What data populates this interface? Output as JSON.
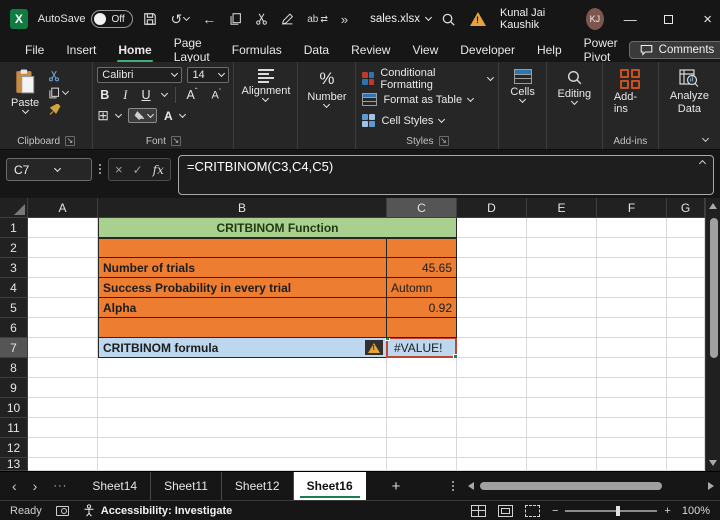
{
  "titlebar": {
    "autosave_label": "AutoSave",
    "autosave_state": "Off",
    "filename": "sales.xlsx",
    "user_name": "Kunal Jai Kaushik",
    "user_initials": "KJ"
  },
  "ribbon_tabs": [
    "File",
    "Insert",
    "Home",
    "Page Layout",
    "Formulas",
    "Data",
    "Review",
    "View",
    "Developer",
    "Help",
    "Power Pivot"
  ],
  "active_tab": "Home",
  "tab_actions": {
    "comments": "Comments"
  },
  "ribbon": {
    "paste": "Paste",
    "clipboard_group": "Clipboard",
    "font_group": "Font",
    "font_name": "Calibri",
    "font_size": "14",
    "bold": "B",
    "italic": "I",
    "underline": "U",
    "font_color_letter": "A",
    "grow_font": "A",
    "shrink_font": "A",
    "alignment": "Alignment",
    "number": "Number",
    "conditional_formatting": "Conditional Formatting",
    "format_as_table": "Format as Table",
    "cell_styles": "Cell Styles",
    "styles_group": "Styles",
    "cells": "Cells",
    "editing": "Editing",
    "addins_button": "Add-ins",
    "addins_group": "Add-ins",
    "analyze_data": "Analyze Data"
  },
  "formula_bar": {
    "name_box": "C7",
    "fx": "fx",
    "formula": "=CRITBINOM(C3,C4,C5)"
  },
  "sheet": {
    "columns": [
      "A",
      "B",
      "C",
      "D",
      "E",
      "F",
      "G"
    ],
    "selected_column": "C",
    "selected_row": 7,
    "rows_visible": 13,
    "cell_map": {
      "B1": {
        "text": "CRITBINOM Function",
        "bg": "green",
        "bold": true,
        "align": "center",
        "span": 2,
        "color": "#1f3a10"
      },
      "B2": {
        "bg": "orange"
      },
      "C2": {
        "bg": "orange"
      },
      "B3": {
        "text": "Number of trials",
        "bg": "orange",
        "bold": true
      },
      "C3": {
        "text": "45.65",
        "bg": "orange",
        "align": "right"
      },
      "B4": {
        "text": "Success Probability in every trial",
        "bg": "orange",
        "bold": true
      },
      "C4": {
        "text": "Automn",
        "bg": "orange"
      },
      "B5": {
        "text": "Alpha",
        "bg": "orange",
        "bold": true
      },
      "C5": {
        "text": "0.92",
        "bg": "orange",
        "align": "right"
      },
      "B6": {
        "bg": "orange"
      },
      "C6": {
        "bg": "orange"
      },
      "B7": {
        "text": "CRITBINOM formula",
        "bg": "blue",
        "bold": true,
        "warning": true
      },
      "C7": {
        "text": "#VALUE!",
        "bg": "blue",
        "error": true
      }
    }
  },
  "sheet_tabs": [
    "Sheet14",
    "Sheet11",
    "Sheet12",
    "Sheet16"
  ],
  "active_sheet": "Sheet16",
  "status_bar": {
    "ready": "Ready",
    "accessibility": "Accessibility: Investigate",
    "zoom": "100%"
  },
  "colors": {
    "green": "#a9d08e",
    "orange": "#ed7d31",
    "blue": "#bdd7ee",
    "error_border": "#c04634",
    "selection_green": "#1e8a52",
    "share_button": "#1f9b57",
    "tab_underline": "#3fae7a",
    "warning_orange": "#e8a33d"
  }
}
